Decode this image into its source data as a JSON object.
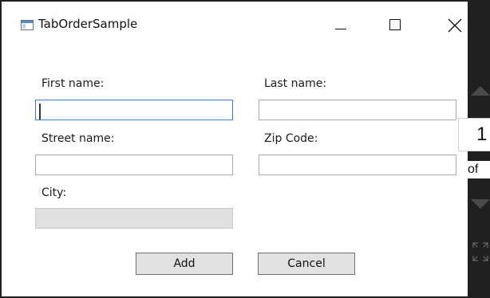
{
  "window": {
    "title": "TabOrderSample",
    "icon": "app-window-icon",
    "controls": {
      "minimize": "minimize-icon",
      "maximize": "maximize-icon",
      "close": "close-icon"
    }
  },
  "form": {
    "first_name_label": "First name:",
    "first_name_value": "",
    "last_name_label": "Last name:",
    "last_name_value": "",
    "street_label": "Street name:",
    "street_value": "",
    "zip_label": "Zip Code:",
    "zip_value": "",
    "city_label": "City:",
    "city_value": ""
  },
  "buttons": {
    "add": "Add",
    "cancel": "Cancel"
  },
  "overlay": {
    "page_number": "1",
    "of_label": "of"
  },
  "colors": {
    "focus_border": "#3c7fd0",
    "disabled_fill": "#e0e0e0",
    "button_fill": "#e1e1e1"
  }
}
